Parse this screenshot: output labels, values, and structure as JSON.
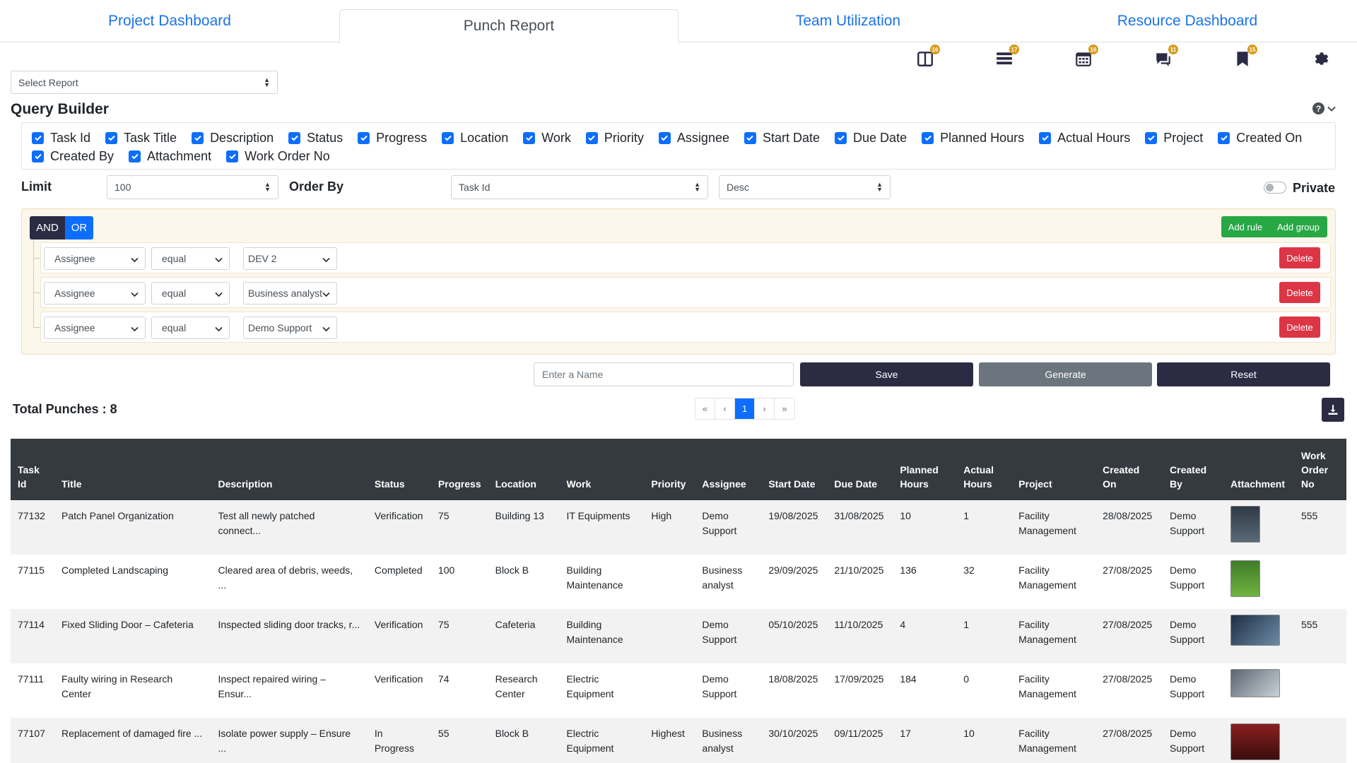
{
  "tabs": [
    {
      "label": "Project Dashboard"
    },
    {
      "label": "Punch Report"
    },
    {
      "label": "Team Utilization"
    },
    {
      "label": "Resource Dashboard"
    }
  ],
  "toolbar": {
    "badges": [
      "16",
      "17",
      "16",
      "11",
      "15"
    ],
    "icons": [
      "board-icon",
      "list-icon",
      "calendar-icon",
      "chat-icon",
      "bookmark-icon",
      "gear-icon"
    ]
  },
  "report_select": {
    "value": "Select Report"
  },
  "query_builder": {
    "title": "Query Builder",
    "columns": [
      "Task Id",
      "Task Title",
      "Description",
      "Status",
      "Progress",
      "Location",
      "Work",
      "Priority",
      "Assignee",
      "Start Date",
      "Due Date",
      "Planned Hours",
      "Actual Hours",
      "Project",
      "Created On",
      "Created By",
      "Attachment",
      "Work Order No"
    ],
    "limit_label": "Limit",
    "limit_value": "100",
    "order_by_label": "Order By",
    "order_by_value": "Task Id",
    "order_dir_value": "Desc",
    "private_label": "Private"
  },
  "rules": {
    "and_label": "AND",
    "or_label": "OR",
    "add_rule_label": "Add rule",
    "add_group_label": "Add group",
    "delete_label": "Delete",
    "items": [
      {
        "field": "Assignee",
        "operator": "equal",
        "value": "DEV 2"
      },
      {
        "field": "Assignee",
        "operator": "equal",
        "value": "Business analyst"
      },
      {
        "field": "Assignee",
        "operator": "equal",
        "value": "Demo Support"
      }
    ]
  },
  "actions": {
    "name_placeholder": "Enter a Name",
    "save_label": "Save",
    "generate_label": "Generate",
    "reset_label": "Reset"
  },
  "summary": {
    "total_label": "Total Punches : 8"
  },
  "pagination": {
    "first": "«",
    "prev": "‹",
    "current": "1",
    "next": "›",
    "last": "»"
  },
  "table": {
    "headers": [
      "Task Id",
      "Title",
      "Description",
      "Status",
      "Progress",
      "Location",
      "Work",
      "Priority",
      "Assignee",
      "Start Date",
      "Due Date",
      "Planned Hours",
      "Actual Hours",
      "Project",
      "Created On",
      "Created By",
      "Attachment",
      "Work Order No"
    ],
    "rows": [
      [
        "77132",
        "Patch Panel Organization",
        "Test all newly patched connect...",
        "Verification",
        "75",
        "Building 13",
        "IT Equipments",
        "High",
        "Demo Support",
        "19/08/2025",
        "31/08/2025",
        "10",
        "1",
        "Facility Management",
        "28/08/2025",
        "Demo Support",
        "",
        "555"
      ],
      [
        "77115",
        "Completed Landscaping",
        "Cleared area of debris, weeds, ...",
        "Completed",
        "100",
        "Block B",
        "Building Maintenance",
        "",
        "Business analyst",
        "29/09/2025",
        "21/10/2025",
        "136",
        "32",
        "Facility Management",
        "27/08/2025",
        "Demo Support",
        "",
        ""
      ],
      [
        "77114",
        "Fixed Sliding Door – Cafeteria",
        "Inspected sliding door tracks, r...",
        "Verification",
        "75",
        "Cafeteria",
        "Building Maintenance",
        "",
        "Demo Support",
        "05/10/2025",
        "11/10/2025",
        "4",
        "1",
        "Facility Management",
        "27/08/2025",
        "Demo Support",
        "",
        "555"
      ],
      [
        "77111",
        "Faulty wiring in Research Center",
        "Inspect repaired wiring – Ensur...",
        "Verification",
        "74",
        "Research Center",
        "Electric Equipment",
        "",
        "Demo Support",
        "18/08/2025",
        "17/09/2025",
        "184",
        "0",
        "Facility Management",
        "27/08/2025",
        "Demo Support",
        "",
        ""
      ],
      [
        "77107",
        "Replacement of damaged fire ...",
        "Isolate power supply – Ensure ...",
        "In Progress",
        "55",
        "Block B",
        "Electric Equipment",
        "Highest",
        "Business analyst",
        "30/10/2025",
        "09/11/2025",
        "17",
        "10",
        "Facility Management",
        "27/08/2025",
        "Demo Support",
        "",
        ""
      ]
    ]
  }
}
